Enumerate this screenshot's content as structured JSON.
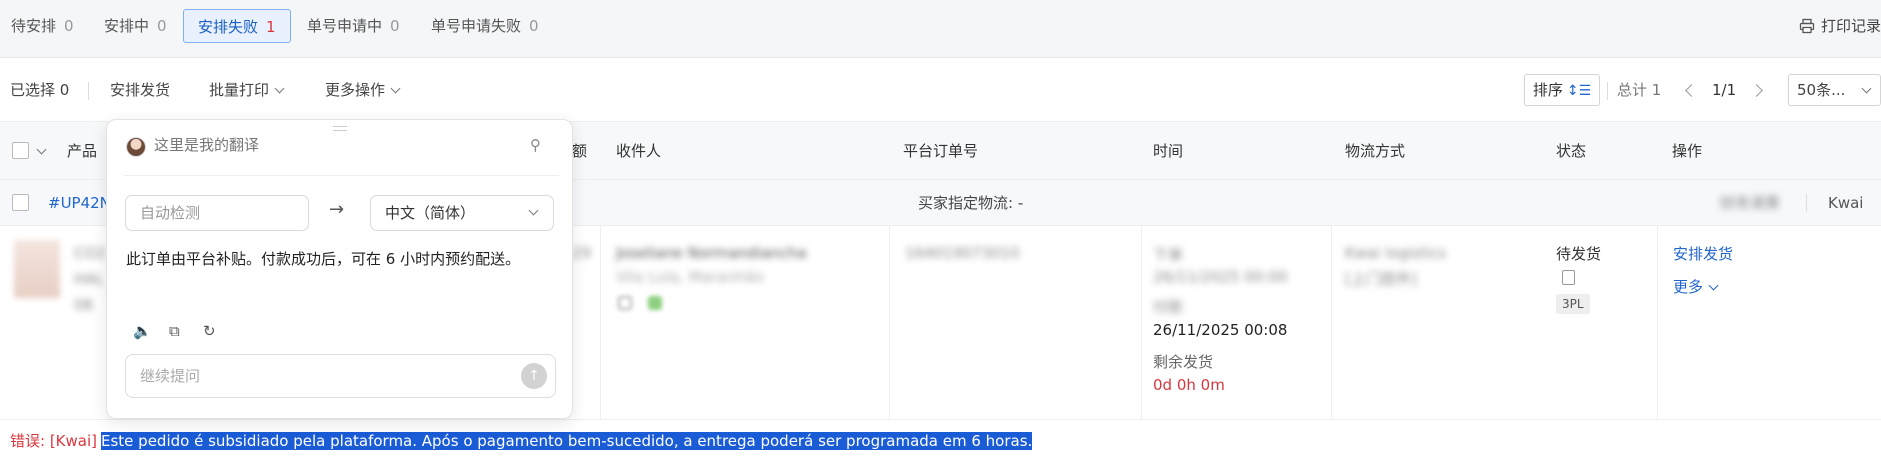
{
  "tabs": [
    {
      "label": "待安排",
      "count": "0"
    },
    {
      "label": "安排中",
      "count": "0"
    },
    {
      "label": "安排失败",
      "count": "1"
    },
    {
      "label": "单号申请中",
      "count": "0"
    },
    {
      "label": "单号申请失败",
      "count": "0"
    }
  ],
  "print_log": "打印记录",
  "toolbar": {
    "selected": "已选择 0",
    "arrange_ship": "安排发货",
    "batch_print": "批量打印",
    "more_ops": "更多操作",
    "sort": "排序",
    "total": "总计 1",
    "page": "1/1",
    "per_page": "50条..."
  },
  "headers": {
    "product": "产品",
    "amount": "额",
    "recipient": "收件人",
    "platform_order": "平台订单号",
    "time": "时间",
    "logistics": "物流方式",
    "status": "状态",
    "actions": "操作"
  },
  "group": {
    "order_id": "#UP42N",
    "buyer_logistics": "买家指定物流: -",
    "blurred_right": "财务清算",
    "platform": "Kwai"
  },
  "row": {
    "product_blur": "CO2",
    "product_blur2": "HAL",
    "product_blur3": "08",
    "amount_blur": "29",
    "recipient_name_blur": "Joseliane Normandiancha",
    "recipient_city_blur": "Vila Lula, Maranhão",
    "platform_order_blur": "164019073010",
    "time_blur1": "下单",
    "time_blur2": "26/11/2025 00:00",
    "time_blur3": "付款",
    "time_value": "26/11/2025 00:08",
    "remaining_label": "剩余发货",
    "remaining_value": "0d 0h 0m",
    "logistics_blur1": "Kwai logistics",
    "logistics_blur2": "[上门揽件]",
    "status": "待发货",
    "status_tag": "3PL",
    "action_arrange": "安排发货",
    "action_more": "更多"
  },
  "error": {
    "label": "错误: [Kwai]",
    "message": "Este pedido é subsidiado pela plataforma. Após o pagamento bem-sucedido, a entrega poderá ser programada em 6 horas."
  },
  "translator": {
    "title": "这里是我的翻译",
    "source_lang": "自动检测",
    "target_lang": "中文（简体）",
    "result": "此订单由平台补贴。付款成功后，可在 6 小时内预约配送。",
    "ask_placeholder": "继续提问"
  },
  "colors": {
    "accent": "#2266cc",
    "error": "#d9363e",
    "selection": "#1a5bd6"
  }
}
